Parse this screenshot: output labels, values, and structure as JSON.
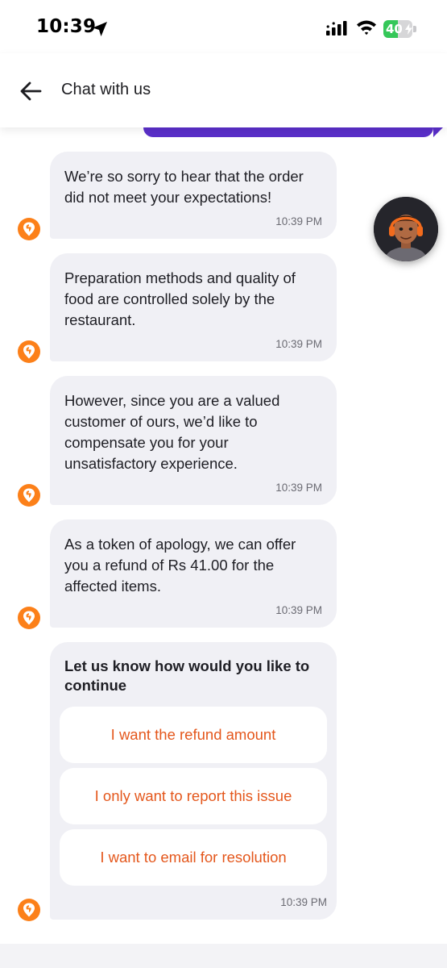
{
  "status_bar": {
    "time": "10:39",
    "battery_level": "40",
    "battery_fraction": 0.4
  },
  "header": {
    "title": "Chat with us"
  },
  "messages": [
    {
      "text": "We’re so sorry to hear that the order\ndid not meet your expectations!",
      "time": "10:39 PM"
    },
    {
      "text": "Preparation methods and quality of\nfood are controlled solely by the\nrestaurant.",
      "time": "10:39 PM"
    },
    {
      "text": "However, since you are a valued\ncustomer of ours, we’d like to\ncompensate you for your\nunsatisfactory experience.",
      "time": "10:39 PM"
    },
    {
      "text": "As a token of apology, we can offer\nyou a refund of Rs 41.00 for the\naffected items.",
      "time": "10:39 PM"
    }
  ],
  "question": {
    "title": "Let us know how would you like to\ncontinue",
    "options": [
      "I want the refund amount",
      "I only want to report this issue",
      "I want to email for resolution"
    ],
    "time": "10:39 PM"
  },
  "colors": {
    "brand_orange": "#fc8019",
    "option_text": "#e4571c",
    "user_bubble": "#5a2fc9",
    "bot_bubble": "#f0f0f5"
  },
  "icons": {
    "back": "arrow-left-icon",
    "bot": "swiggy-logo-icon",
    "location": "location-arrow-icon",
    "signal": "cellular-signal-icon",
    "wifi": "wifi-icon"
  }
}
